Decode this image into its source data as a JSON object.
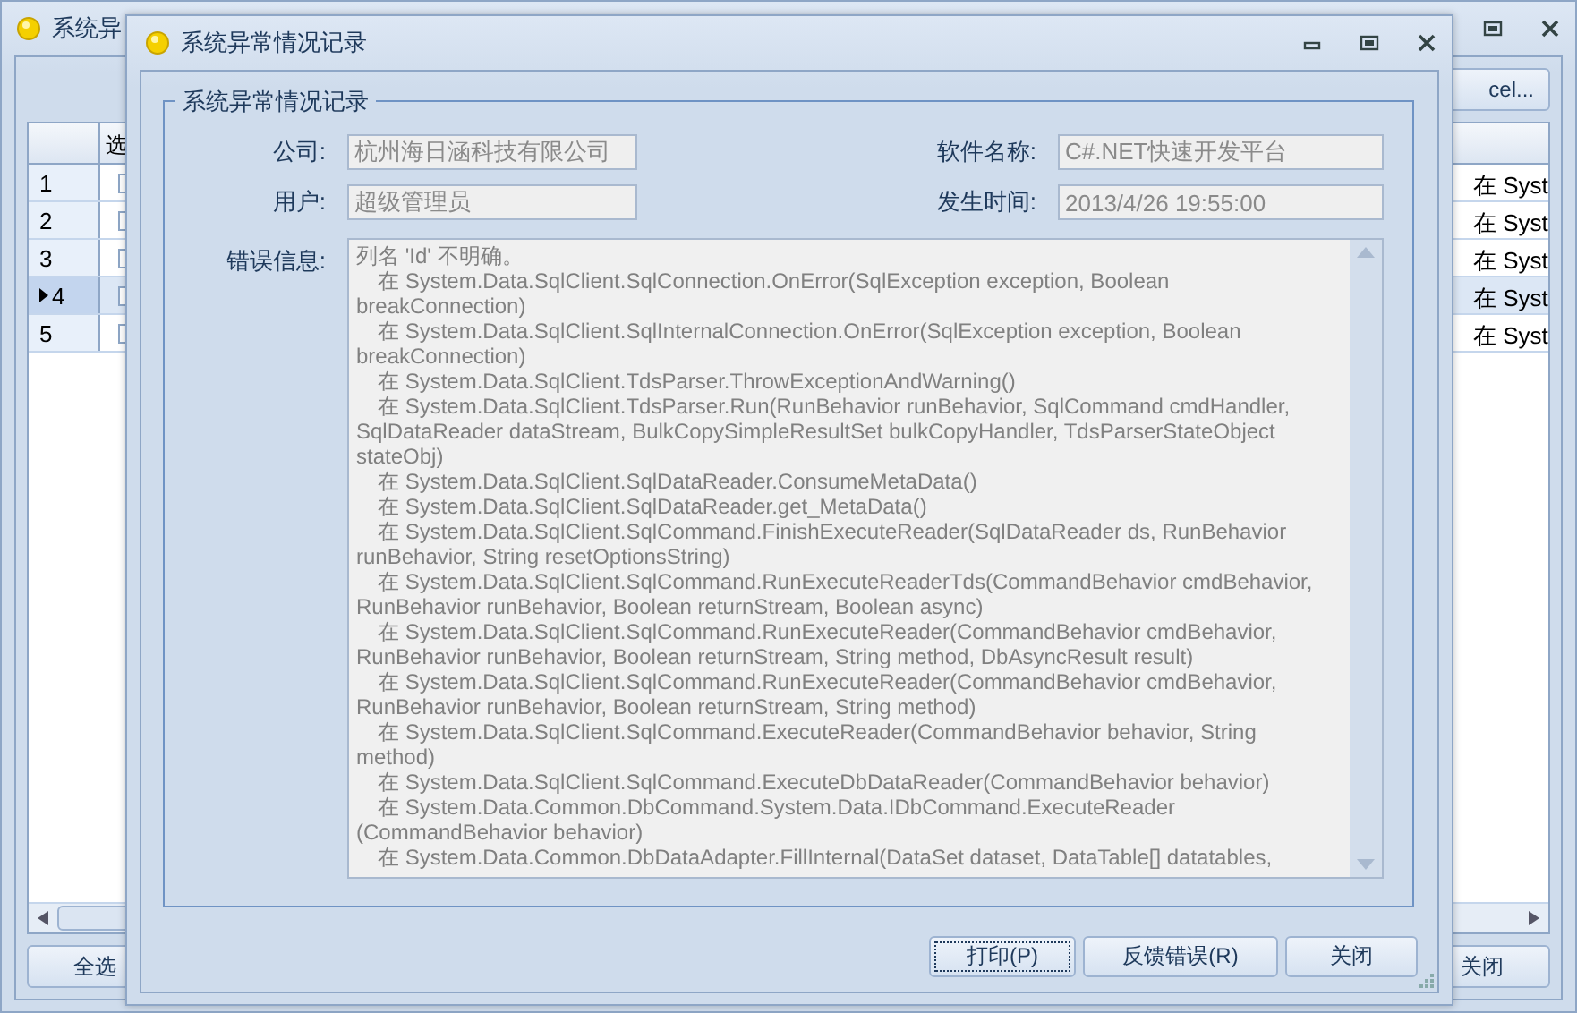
{
  "back_window": {
    "title": "系统异",
    "export_button": "cel...",
    "grid": {
      "columns": [
        "选"
      ],
      "rows": [
        {
          "number": "1",
          "selected": false,
          "message": "在 Syst"
        },
        {
          "number": "2",
          "selected": false,
          "message": "在 Syst"
        },
        {
          "number": "3",
          "selected": false,
          "message": "在 Syst"
        },
        {
          "number": "4",
          "selected": true,
          "message": "在 Syst"
        },
        {
          "number": "5",
          "selected": false,
          "message": "在 Syst"
        }
      ]
    },
    "buttons": [
      "全选",
      "关闭"
    ]
  },
  "dialog": {
    "title": "系统异常情况记录",
    "group_title": "系统异常情况记录",
    "fields": [
      {
        "label": "公司:",
        "value": "杭州海日涵科技有限公司"
      },
      {
        "label": "软件名称:",
        "value": "C#.NET快速开发平台"
      },
      {
        "label": "用户:",
        "value": "超级管理员"
      },
      {
        "label": "发生时间:",
        "value": "2013/4/26 19:55:00"
      }
    ],
    "error_label": "错误信息:",
    "error_message": "列名 'Id' 不明确。",
    "stack_frames": [
      [
        "在 System.Data.SqlClient.SqlConnection.OnError(SqlException exception, Boolean",
        "breakConnection)"
      ],
      [
        "在 System.Data.SqlClient.SqlInternalConnection.OnError(SqlException exception, Boolean",
        "breakConnection)"
      ],
      [
        "在 System.Data.SqlClient.TdsParser.ThrowExceptionAndWarning()"
      ],
      [
        "在 System.Data.SqlClient.TdsParser.Run(RunBehavior runBehavior, SqlCommand cmdHandler,",
        "SqlDataReader dataStream, BulkCopySimpleResultSet bulkCopyHandler, TdsParserStateObject",
        "stateObj)"
      ],
      [
        "在 System.Data.SqlClient.SqlDataReader.ConsumeMetaData()"
      ],
      [
        "在 System.Data.SqlClient.SqlDataReader.get_MetaData()"
      ],
      [
        "在 System.Data.SqlClient.SqlCommand.FinishExecuteReader(SqlDataReader ds, RunBehavior",
        "runBehavior, String resetOptionsString)"
      ],
      [
        "在 System.Data.SqlClient.SqlCommand.RunExecuteReaderTds(CommandBehavior cmdBehavior,",
        "RunBehavior runBehavior, Boolean returnStream, Boolean async)"
      ],
      [
        "在 System.Data.SqlClient.SqlCommand.RunExecuteReader(CommandBehavior cmdBehavior,",
        "RunBehavior runBehavior, Boolean returnStream, String method, DbAsyncResult result)"
      ],
      [
        "在 System.Data.SqlClient.SqlCommand.RunExecuteReader(CommandBehavior cmdBehavior,",
        "RunBehavior runBehavior, Boolean returnStream, String method)"
      ],
      [
        "在 System.Data.SqlClient.SqlCommand.ExecuteReader(CommandBehavior behavior, String",
        "method)"
      ],
      [
        "在 System.Data.SqlClient.SqlCommand.ExecuteDbDataReader(CommandBehavior behavior)"
      ],
      [
        "在 System.Data.Common.DbCommand.System.Data.IDbCommand.ExecuteReader",
        "(CommandBehavior behavior)"
      ],
      [
        "在 System.Data.Common.DbDataAdapter.FillInternal(DataSet dataset, DataTable[] datatables,"
      ]
    ],
    "buttons": [
      {
        "label": "打印(P)",
        "focused": true
      },
      {
        "label": "反馈错误(R)",
        "focused": false
      },
      {
        "label": "关闭",
        "focused": false
      }
    ]
  }
}
